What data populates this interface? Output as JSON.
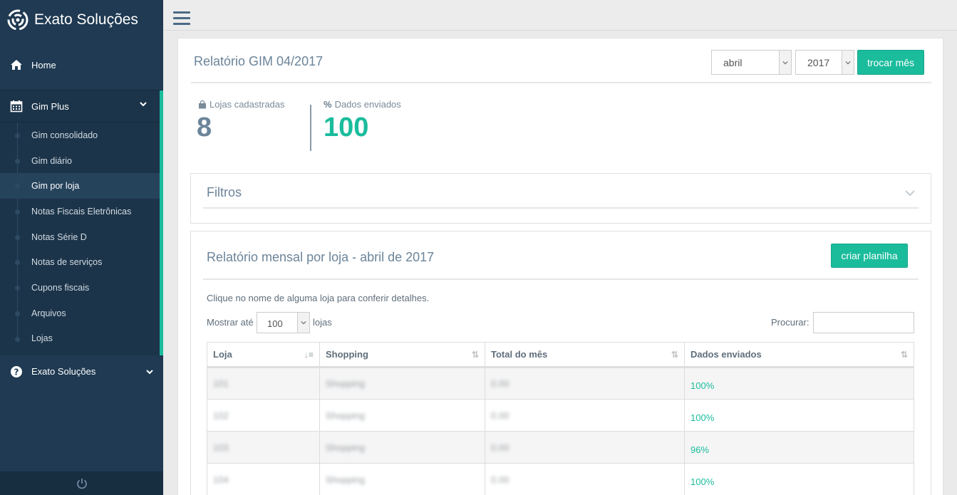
{
  "brand": {
    "name": "Exato Soluções"
  },
  "sidebar": {
    "home_label": "Home",
    "gim_label": "Gim Plus",
    "items": [
      {
        "label": "Gim consolidado",
        "active": false
      },
      {
        "label": "Gim diário",
        "active": false
      },
      {
        "label": "Gim por loja",
        "active": true
      },
      {
        "label": "Notas Fiscais Eletrônicas",
        "active": false
      },
      {
        "label": "Notas Série D",
        "active": false
      },
      {
        "label": "Notas de serviços",
        "active": false
      },
      {
        "label": "Cupons fiscais",
        "active": false
      },
      {
        "label": "Arquivos",
        "active": false
      },
      {
        "label": "Lojas",
        "active": false
      }
    ],
    "exato_label": "Exato Soluções"
  },
  "header": {
    "title": "Relatório GIM 04/2017",
    "month_value": "abril",
    "year_value": "2017",
    "change_button": "trocar mês"
  },
  "stats": {
    "stores_label": "Lojas cadastradas",
    "stores_value": "8",
    "sent_label": "Dados enviados",
    "sent_value": "100"
  },
  "filters": {
    "title": "Filtros"
  },
  "report": {
    "title": "Relatório mensal por loja - abril de 2017",
    "spreadsheet_button": "criar planilha",
    "hint": "Clique no nome de alguma loja para conferir detalhes.",
    "show_prefix": "Mostrar até",
    "show_value": "100",
    "show_suffix": "lojas",
    "search_label": "Procurar:",
    "columns": [
      "Loja",
      "Shopping",
      "Total do mês",
      "Dados enviados"
    ],
    "rows": [
      {
        "loja": "101",
        "shopping": "Shopping",
        "total": "0.00",
        "pct": "100%"
      },
      {
        "loja": "102",
        "shopping": "Shopping",
        "total": "0.00",
        "pct": "100%"
      },
      {
        "loja": "103",
        "shopping": "Shopping",
        "total": "0.00",
        "pct": "96%"
      },
      {
        "loja": "104",
        "shopping": "Shopping",
        "total": "0.00",
        "pct": "100%"
      }
    ]
  },
  "colors": {
    "accent": "#1abc9c",
    "sidebar": "#1f3a52"
  }
}
